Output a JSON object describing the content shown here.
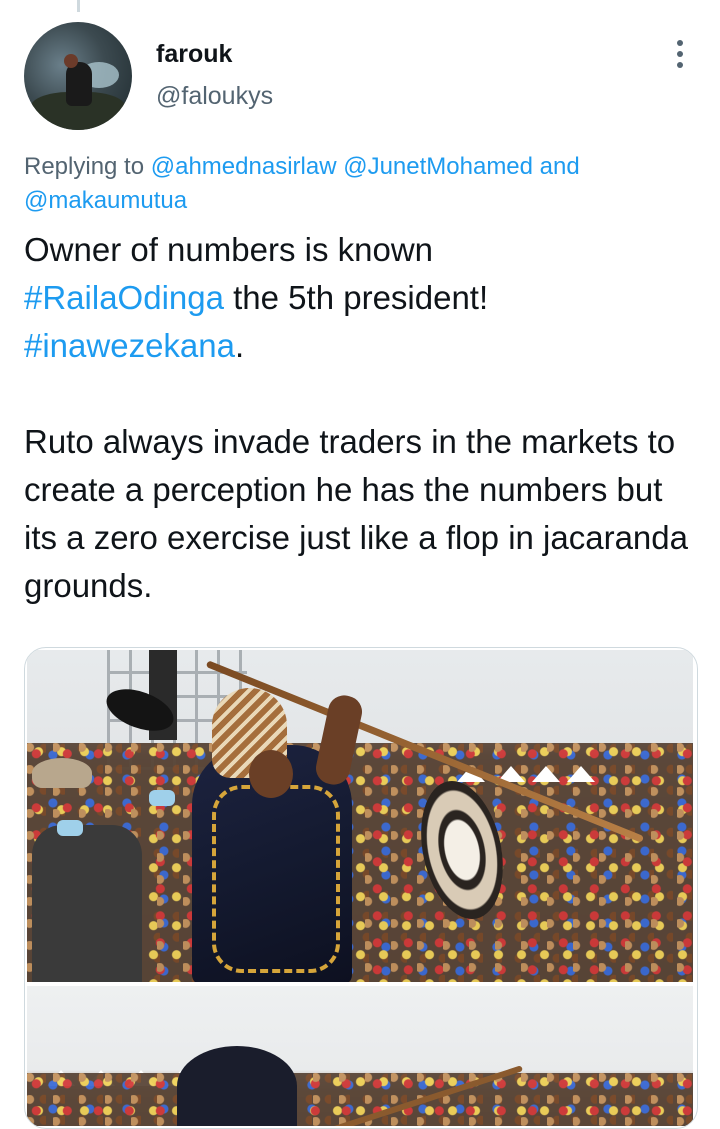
{
  "tweet": {
    "author": {
      "display_name": "farouk",
      "handle": "@faloukys"
    },
    "more_icon": "more-vertical-icon",
    "replying": {
      "prefix": "Replying to",
      "mention_1": "@ahmednasirlaw",
      "mention_2": "@JunetMohamed",
      "conjunction": "and",
      "mention_3": "@makaumutua"
    },
    "text": {
      "line1": "Owner of numbers is known",
      "hashtag_1": "#RailaOdinga",
      "line2_rest": " the 5th president!",
      "hashtag_2": "#inawezekana",
      "line3_rest": ".",
      "paragraph2": "Ruto always invade traders in the markets to create a perception he has the numbers but its a zero exercise just like a flop in jacaranda grounds."
    }
  },
  "colors": {
    "link": "#1d9bf0",
    "secondary_text": "#536471",
    "primary_text": "#0f1419",
    "border": "#cfd9de"
  }
}
